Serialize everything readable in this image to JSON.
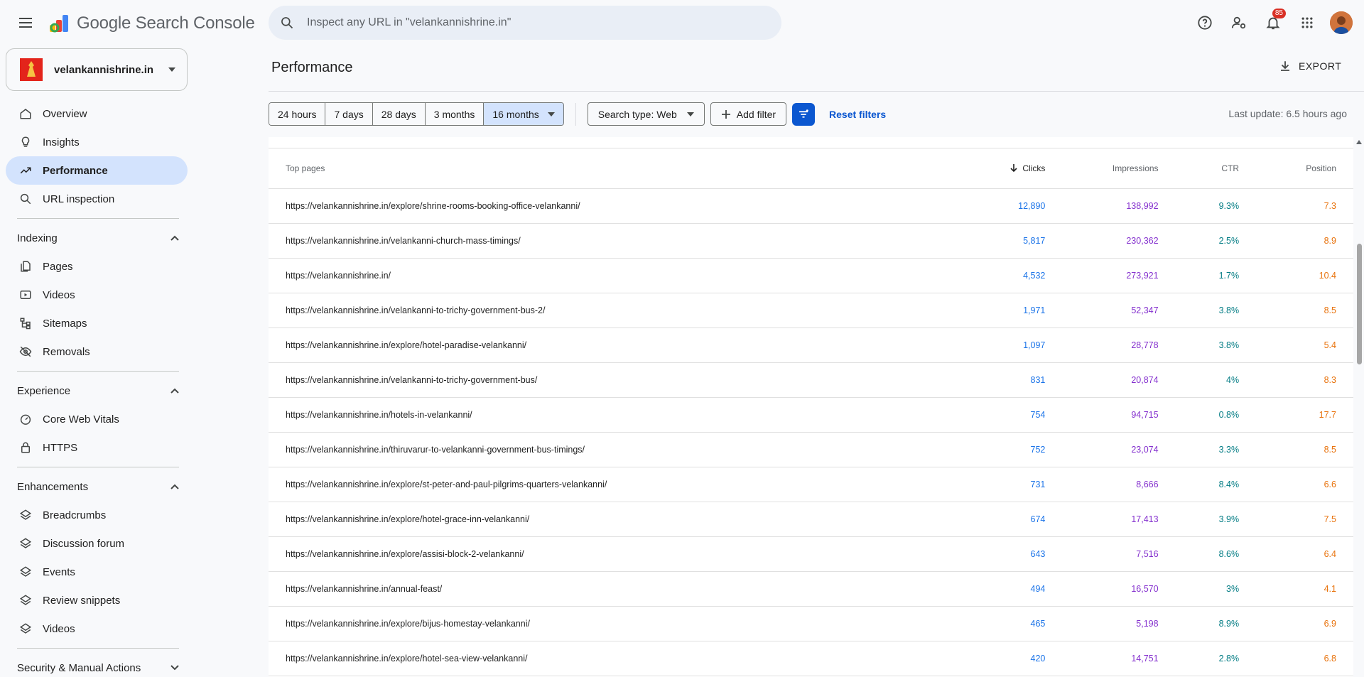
{
  "app": {
    "title": "Google Search Console",
    "search_placeholder": "Inspect any URL in \"velankannishrine.in\"",
    "notification_count": "85"
  },
  "property": {
    "name": "velankannishrine.in"
  },
  "sidebar": {
    "overview": "Overview",
    "insights": "Insights",
    "performance": "Performance",
    "url_inspection": "URL inspection",
    "indexing": {
      "label": "Indexing",
      "items": [
        "Pages",
        "Videos",
        "Sitemaps",
        "Removals"
      ]
    },
    "experience": {
      "label": "Experience",
      "items": [
        "Core Web Vitals",
        "HTTPS"
      ]
    },
    "enhancements": {
      "label": "Enhancements",
      "items": [
        "Breadcrumbs",
        "Discussion forum",
        "Events",
        "Review snippets",
        "Videos"
      ]
    },
    "security": {
      "label": "Security & Manual Actions"
    }
  },
  "header": {
    "title": "Performance",
    "export_label": "EXPORT"
  },
  "filters": {
    "date_ranges": [
      "24 hours",
      "7 days",
      "28 days",
      "3 months",
      "16 months"
    ],
    "selected_range": "16 months",
    "search_type": "Search type: Web",
    "add_filter": "Add filter",
    "reset": "Reset filters",
    "last_update": "Last update: 6.5 hours ago"
  },
  "table": {
    "headers": {
      "page": "Top pages",
      "clicks": "Clicks",
      "impressions": "Impressions",
      "ctr": "CTR",
      "position": "Position"
    },
    "sorted_by": "Clicks",
    "rows": [
      {
        "page": "https://velankannishrine.in/explore/shrine-rooms-booking-office-velankanni/",
        "clicks": "12,890",
        "impressions": "138,992",
        "ctr": "9.3%",
        "position": "7.3"
      },
      {
        "page": "https://velankannishrine.in/velankanni-church-mass-timings/",
        "clicks": "5,817",
        "impressions": "230,362",
        "ctr": "2.5%",
        "position": "8.9"
      },
      {
        "page": "https://velankannishrine.in/",
        "clicks": "4,532",
        "impressions": "273,921",
        "ctr": "1.7%",
        "position": "10.4"
      },
      {
        "page": "https://velankannishrine.in/velankanni-to-trichy-government-bus-2/",
        "clicks": "1,971",
        "impressions": "52,347",
        "ctr": "3.8%",
        "position": "8.5"
      },
      {
        "page": "https://velankannishrine.in/explore/hotel-paradise-velankanni/",
        "clicks": "1,097",
        "impressions": "28,778",
        "ctr": "3.8%",
        "position": "5.4"
      },
      {
        "page": "https://velankannishrine.in/velankanni-to-trichy-government-bus/",
        "clicks": "831",
        "impressions": "20,874",
        "ctr": "4%",
        "position": "8.3"
      },
      {
        "page": "https://velankannishrine.in/hotels-in-velankanni/",
        "clicks": "754",
        "impressions": "94,715",
        "ctr": "0.8%",
        "position": "17.7"
      },
      {
        "page": "https://velankannishrine.in/thiruvarur-to-velankanni-government-bus-timings/",
        "clicks": "752",
        "impressions": "23,074",
        "ctr": "3.3%",
        "position": "8.5"
      },
      {
        "page": "https://velankannishrine.in/explore/st-peter-and-paul-pilgrims-quarters-velankanni/",
        "clicks": "731",
        "impressions": "8,666",
        "ctr": "8.4%",
        "position": "6.6"
      },
      {
        "page": "https://velankannishrine.in/explore/hotel-grace-inn-velankanni/",
        "clicks": "674",
        "impressions": "17,413",
        "ctr": "3.9%",
        "position": "7.5"
      },
      {
        "page": "https://velankannishrine.in/explore/assisi-block-2-velankanni/",
        "clicks": "643",
        "impressions": "7,516",
        "ctr": "8.6%",
        "position": "6.4"
      },
      {
        "page": "https://velankannishrine.in/annual-feast/",
        "clicks": "494",
        "impressions": "16,570",
        "ctr": "3%",
        "position": "4.1"
      },
      {
        "page": "https://velankannishrine.in/explore/bijus-homestay-velankanni/",
        "clicks": "465",
        "impressions": "5,198",
        "ctr": "8.9%",
        "position": "6.9"
      },
      {
        "page": "https://velankannishrine.in/explore/hotel-sea-view-velankanni/",
        "clicks": "420",
        "impressions": "14,751",
        "ctr": "2.8%",
        "position": "6.8"
      }
    ]
  },
  "colors": {
    "clicks": "#1a73e8",
    "impressions": "#8430ce",
    "ctr": "#007b83",
    "position": "#e8710a",
    "accent": "#0b57d0",
    "active_nav": "#d3e3fd"
  }
}
